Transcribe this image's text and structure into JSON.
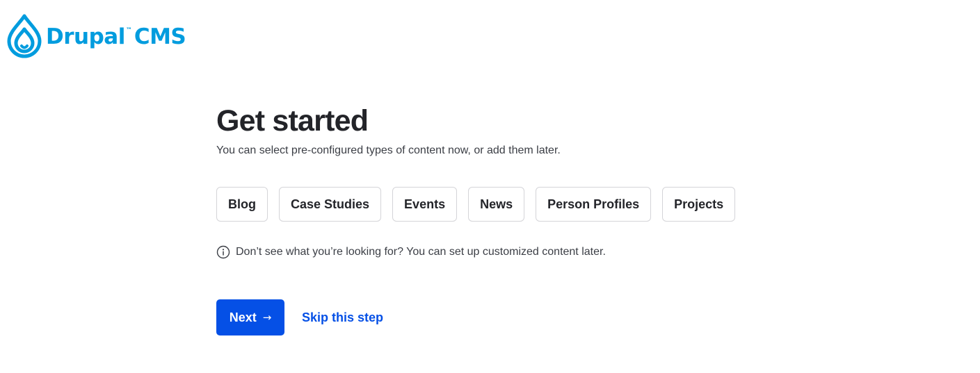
{
  "logo": {
    "brand": "Drupal",
    "trademark": "™",
    "product": "CMS",
    "icon": "drupal-drop-icon",
    "color": "#009cde"
  },
  "main": {
    "title": "Get started",
    "subtitle": "You can select pre-configured types of content now, or add them later.",
    "options": [
      {
        "label": "Blog"
      },
      {
        "label": "Case Studies"
      },
      {
        "label": "Events"
      },
      {
        "label": "News"
      },
      {
        "label": "Person Profiles"
      },
      {
        "label": "Projects"
      }
    ],
    "hint": {
      "icon": "info-icon",
      "text": "Don’t see what you’re looking for? You can set up customized content later."
    }
  },
  "actions": {
    "next_label": "Next",
    "next_icon": "arrow-right-icon",
    "next_arrow": "→",
    "skip_label": "Skip this step",
    "accent_color": "#0550e6"
  }
}
